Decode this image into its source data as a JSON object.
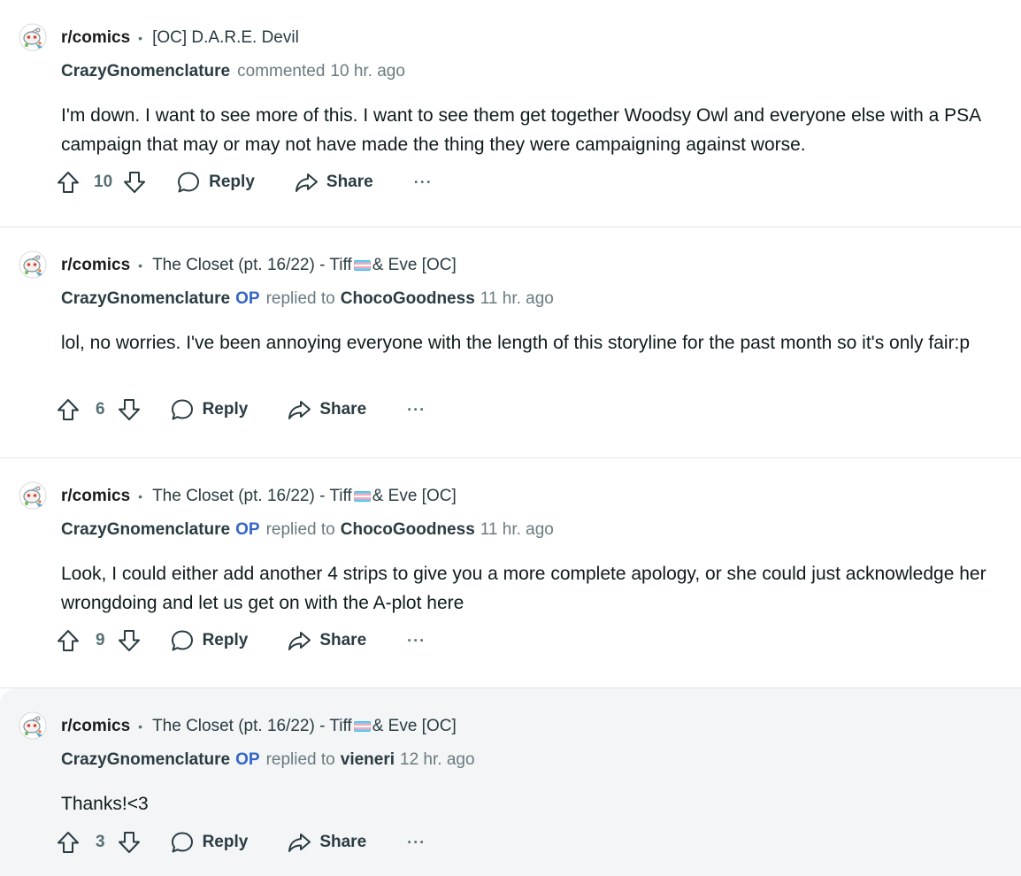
{
  "actions": {
    "reply": "Reply",
    "share": "Share",
    "more": "···",
    "op_badge": "OP"
  },
  "comments": [
    {
      "subreddit": "r/comics",
      "post_pre": "[OC] D.A.R.E. Devil",
      "post_post": "",
      "author": "CrazyGnomenclature",
      "verb": "commented",
      "reply_to": "",
      "time": "10 hr. ago",
      "body": "I'm down. I want to see more of this. I want to see them get together Woodsy Owl and everyone else with a PSA campaign that may or may not have made the thing they were campaigning against worse.",
      "votes": "10"
    },
    {
      "subreddit": "r/comics",
      "post_pre": "The Closet (pt. 16/22) - Tiff",
      "post_post": "& Eve [OC]",
      "author": "CrazyGnomenclature",
      "verb": "replied to",
      "reply_to": "ChocoGoodness",
      "time": "11 hr. ago",
      "body": "lol, no worries. I've been annoying everyone with the length of this storyline for the past month so it's only fair:p",
      "votes": "6"
    },
    {
      "subreddit": "r/comics",
      "post_pre": "The Closet (pt. 16/22) - Tiff",
      "post_post": "& Eve [OC]",
      "author": "CrazyGnomenclature",
      "verb": "replied to",
      "reply_to": "ChocoGoodness",
      "time": "11 hr. ago",
      "body": "Look, I could either add another 4 strips to give you a more complete apology, or she could just acknowledge her wrongdoing and let us get on with the A-plot here",
      "votes": "9"
    },
    {
      "subreddit": "r/comics",
      "post_pre": "The Closet (pt. 16/22) - Tiff",
      "post_post": "& Eve [OC]",
      "author": "CrazyGnomenclature",
      "verb": "replied to",
      "reply_to": "vieneri",
      "time": "12 hr. ago",
      "body": "Thanks!<3",
      "votes": "3"
    }
  ],
  "colors": {
    "op": "#3465c9",
    "highlight_bg": "#f3f5f7",
    "flag": [
      "#5bcefa",
      "#f5a9b8",
      "#ffffff"
    ]
  }
}
